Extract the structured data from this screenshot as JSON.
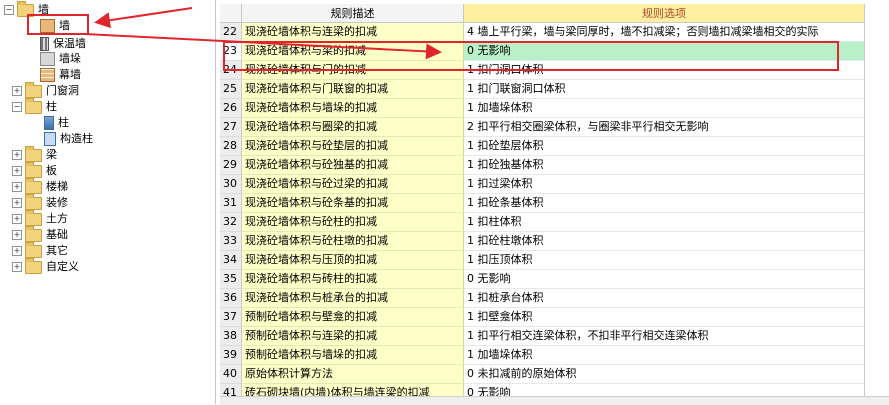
{
  "tree": {
    "nodes": [
      {
        "id": "wall-root",
        "label": "墙",
        "toggle": "−",
        "icon": "folder",
        "depth": 0
      },
      {
        "id": "wall",
        "label": "墙",
        "icon": "wall",
        "depth": 1,
        "selected": true
      },
      {
        "id": "insulation",
        "label": "保温墙",
        "icon": "insulation",
        "depth": 1
      },
      {
        "id": "duo",
        "label": "墙垛",
        "icon": "duo",
        "depth": 1
      },
      {
        "id": "curtain",
        "label": "幕墙",
        "icon": "curtain",
        "depth": 1
      },
      {
        "id": "doors",
        "label": "门窗洞",
        "toggle": "+",
        "icon": "folder",
        "depth": 0
      },
      {
        "id": "column-root",
        "label": "柱",
        "toggle": "−",
        "icon": "folder",
        "depth": 0
      },
      {
        "id": "column",
        "label": "柱",
        "icon": "column",
        "depth": 1
      },
      {
        "id": "gzz",
        "label": "构造柱",
        "icon": "gzz",
        "depth": 1
      },
      {
        "id": "beam",
        "label": "梁",
        "toggle": "+",
        "icon": "folder",
        "depth": 0
      },
      {
        "id": "slab",
        "label": "板",
        "toggle": "+",
        "icon": "folder",
        "depth": 0
      },
      {
        "id": "stairs",
        "label": "楼梯",
        "toggle": "+",
        "icon": "folder",
        "depth": 0
      },
      {
        "id": "decoration",
        "label": "装修",
        "toggle": "+",
        "icon": "folder",
        "depth": 0
      },
      {
        "id": "earth",
        "label": "土方",
        "toggle": "+",
        "icon": "folder",
        "depth": 0
      },
      {
        "id": "foundation",
        "label": "基础",
        "toggle": "+",
        "icon": "folder",
        "depth": 0
      },
      {
        "id": "other",
        "label": "其它",
        "toggle": "+",
        "icon": "folder",
        "depth": 0
      },
      {
        "id": "custom",
        "label": "自定义",
        "toggle": "+",
        "icon": "folder",
        "depth": 0
      }
    ]
  },
  "grid": {
    "header_num": "",
    "header_desc": "规则描述",
    "header_opt": "规则选项",
    "colors": {
      "header_opt_bg": "#fff0a0",
      "header_desc_bg": "#f4f4f4",
      "selected_opt": "#b8f0c8",
      "desc_bg": "#ffffc8",
      "annot": "#e0262c"
    },
    "rows": [
      {
        "num": "22",
        "desc": "现浇砼墙体积与连梁的扣减",
        "opt": "4  墙上平行梁，墙与梁同厚时，墙不扣减梁；否则墙扣减梁墙相交的实际"
      },
      {
        "num": "23",
        "desc": "现浇砼墙体积与梁的扣减",
        "opt": "0  无影响",
        "selected": true
      },
      {
        "num": "24",
        "desc": "现浇砼墙体积与门的扣减",
        "opt": "1  扣门洞口体积"
      },
      {
        "num": "25",
        "desc": "现浇砼墙体积与门联窗的扣减",
        "opt": "1  扣门联窗洞口体积"
      },
      {
        "num": "26",
        "desc": "现浇砼墙体积与墙垛的扣减",
        "opt": "1   加墙垛体积"
      },
      {
        "num": "27",
        "desc": "现浇砼墙体积与圈梁的扣减",
        "opt": "2   扣平行相交圈梁体积，与圈梁非平行相交无影响"
      },
      {
        "num": "28",
        "desc": "现浇砼墙体积与砼垫层的扣减",
        "opt": "1   扣砼垫层体积"
      },
      {
        "num": "29",
        "desc": "现浇砼墙体积与砼独基的扣减",
        "opt": "1   扣砼独基体积"
      },
      {
        "num": "30",
        "desc": "现浇砼墙体积与砼过梁的扣减",
        "opt": "1   扣过梁体积"
      },
      {
        "num": "31",
        "desc": "现浇砼墙体积与砼条基的扣减",
        "opt": "1   扣砼条基体积"
      },
      {
        "num": "32",
        "desc": "现浇砼墙体积与砼柱的扣减",
        "opt": "1   扣柱体积"
      },
      {
        "num": "33",
        "desc": "现浇砼墙体积与砼柱墩的扣减",
        "opt": "1   扣砼柱墩体积"
      },
      {
        "num": "34",
        "desc": "现浇砼墙体积与压顶的扣减",
        "opt": "1   扣压顶体积"
      },
      {
        "num": "35",
        "desc": "现浇砼墙体积与砖柱的扣减",
        "opt": "0   无影响"
      },
      {
        "num": "36",
        "desc": "现浇砼墙体积与桩承台的扣减",
        "opt": "1   扣桩承台体积"
      },
      {
        "num": "37",
        "desc": "预制砼墙体积与壁龛的扣减",
        "opt": "1   扣壁龛体积"
      },
      {
        "num": "38",
        "desc": "预制砼墙体积与连梁的扣减",
        "opt": "1   扣平行相交连梁体积，不扣非平行相交连梁体积"
      },
      {
        "num": "39",
        "desc": "预制砼墙体积与墙垛的扣减",
        "opt": "1   加墙垛体积"
      },
      {
        "num": "40",
        "desc": "原始体积计算方法",
        "opt": "0  未扣减前的原始体积"
      },
      {
        "num": "41",
        "desc": "砖石砌块墙(内墙)体积与墙连梁的扣减",
        "opt": "0   无影响"
      }
    ]
  }
}
